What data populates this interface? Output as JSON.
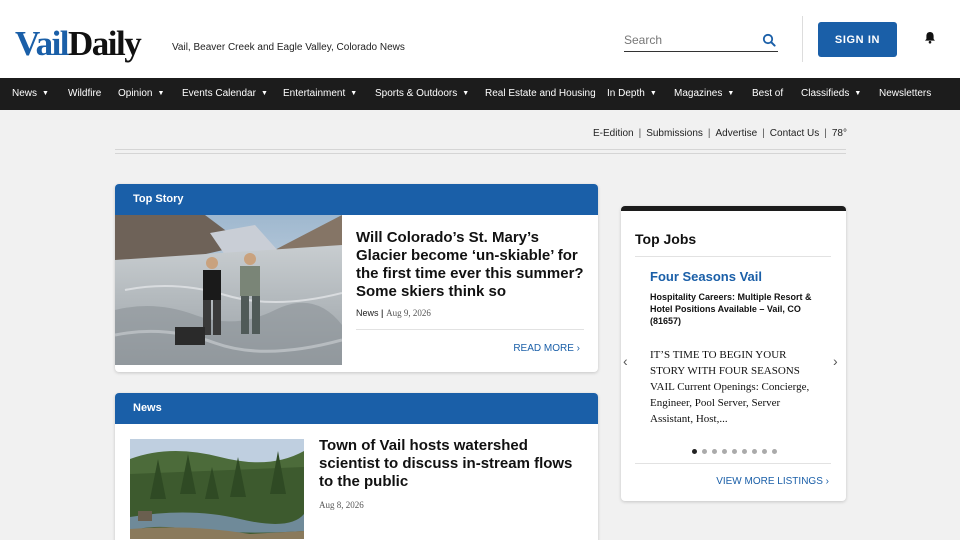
{
  "header": {
    "logo_part1": "Vail",
    "logo_part2": "Daily",
    "tagline": "Vail, Beaver Creek and Eagle Valley, Colorado News",
    "search_placeholder": "Search",
    "sign_in_label": "SIGN IN"
  },
  "nav": {
    "items": [
      {
        "label": "News",
        "dropdown": true
      },
      {
        "label": "Wildfire",
        "dropdown": false
      },
      {
        "label": "Opinion",
        "dropdown": true
      },
      {
        "label": "Events Calendar",
        "dropdown": true
      },
      {
        "label": "Entertainment",
        "dropdown": true
      },
      {
        "label": "Sports & Outdoors",
        "dropdown": true
      },
      {
        "label": "Real Estate and Housing",
        "dropdown": false
      },
      {
        "label": "In Depth",
        "dropdown": true
      },
      {
        "label": "Magazines",
        "dropdown": true
      },
      {
        "label": "Best of",
        "dropdown": false
      },
      {
        "label": "Classifieds",
        "dropdown": true
      },
      {
        "label": "Newsletters",
        "dropdown": false
      }
    ]
  },
  "util_links": {
    "items": [
      "E-Edition",
      "Submissions",
      "Advertise",
      "Contact Us"
    ],
    "temperature": "78°"
  },
  "top_story": {
    "section_label": "Top Story",
    "title": "Will Colorado’s St. Mary’s Glacier become ‘un-skiable’ for the first time ever this summer? Some skiers think so",
    "category": "News",
    "date": "Aug 9, 2026",
    "read_more": "READ MORE"
  },
  "news_section": {
    "section_label": "News",
    "title": "Town of Vail hosts watershed scientist to discuss in-stream flows to the public",
    "date": "Aug 8, 2026"
  },
  "jobs": {
    "title": "Top Jobs",
    "company": "Four Seasons Vail",
    "position": "Hospitality Careers: Multiple Resort & Hotel Positions Available – Vail, CO (81657)",
    "description": "IT’S TIME TO BEGIN YOUR STORY WITH FOUR SEASONS VAIL Current Openings: Concierge, Engineer, Pool Server, Server Assistant, Host,...",
    "slide_count": 9,
    "active_slide": 1,
    "view_more": "VIEW MORE LISTINGS"
  },
  "colors": {
    "brand_blue": "#1a5fa8",
    "nav_bg": "#1c1c1c",
    "page_bg": "#f1f1f1"
  }
}
